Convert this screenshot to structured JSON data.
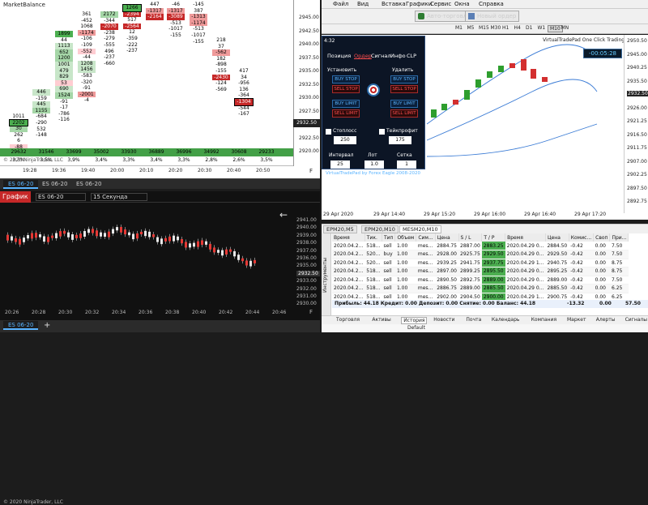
{
  "mb": {
    "title": "MarketBalance",
    "axis": [
      "2945.00",
      "2942.50",
      "2940.00",
      "2937.50",
      "2935.00",
      "2932.50",
      "2930.00",
      "2927.50",
      "2925.00",
      "2922.50",
      "2920.00"
    ],
    "price": "2932.50",
    "totals": [
      "29632",
      "31546",
      "33699",
      "35002",
      "33930",
      "36889",
      "36996",
      "34992",
      "30608",
      "29233"
    ],
    "percents": [
      "3,3%",
      "3,5%",
      "3,9%",
      "3,4%",
      "3,3%",
      "3,4%",
      "3,3%",
      "2,8%",
      "2,6%",
      "3,5%"
    ],
    "times": [
      "19:28",
      "19:36",
      "19:40",
      "20:00",
      "20:10",
      "20:20",
      "20:30",
      "20:40",
      "20:50"
    ],
    "copyright": "© 2020 NinjaTrader, LLC",
    "axis_toggle": "F"
  },
  "tabs1": [
    "ES 06-20",
    "ES 06-20",
    "ES 06-20"
  ],
  "chart2": {
    "label": "График",
    "instrument": "ES 06-20",
    "period": "15 Секунда",
    "axis": [
      "2941.00",
      "2940.00",
      "2939.00",
      "2938.00",
      "2937.00",
      "2936.00",
      "2935.00",
      "2934.00",
      "2933.00",
      "2932.00",
      "2931.00",
      "2930.00"
    ],
    "price": "2932.50",
    "times": [
      "20:26",
      "20:28",
      "20:30",
      "20:32",
      "20:34",
      "20:36",
      "20:38",
      "20:40",
      "20:42",
      "20:44",
      "20:46"
    ],
    "copyright": "© 2020 NinjaTrader, LLC",
    "axis_toggle": "F",
    "back_arrow": "←"
  },
  "tabs2": [
    "ES 06-20"
  ],
  "mt": {
    "menu": [
      "Файл",
      "Вид",
      "Вставка",
      "Графики",
      "Сервис",
      "Окна",
      "Справка"
    ],
    "toolbar": {
      "auto": "Авто-торговля",
      "new_order": "Новый ордер"
    },
    "timeframes": [
      "M1",
      "M5",
      "M15",
      "M30",
      "H1",
      "H4",
      "D1",
      "W1",
      "MN"
    ],
    "tf_active": "M10",
    "chart_title": "VirtualTradePad One Click Trading Panel",
    "timer": "-00:05:28",
    "axis": [
      "2950.50",
      "2945.00",
      "2940.25",
      "2935.50",
      "2930.75",
      "2926.00",
      "2921.25",
      "2916.50",
      "2911.75",
      "2907.00",
      "2902.25",
      "2897.50",
      "2892.75"
    ],
    "bid_price": "2932.50",
    "times": [
      "29 Apr 2020",
      "29 Apr 14:40",
      "29 Apr 15:20",
      "29 Apr 16:00",
      "29 Apr 16:40",
      "29 Apr 17:20"
    ],
    "chart_tabs": [
      "EPM20,M5",
      "EPM20,M10",
      "MESM20,M10"
    ]
  },
  "vp": {
    "title": "4:32",
    "tabs": [
      "Позиция",
      "Ордер",
      "Сигнал",
      "Инфо",
      "CLP"
    ],
    "set": "Установить",
    "del": "Удалить",
    "buy_stop": "BUY STOP",
    "sell_stop": "SELL STOP",
    "buy_limit": "BUY LIMIT",
    "sell_limit": "SELL LIMIT",
    "sl_label": "Стоплосс",
    "sl_value": "250",
    "tp_label": "Тейкпрофит",
    "tp_value": "175",
    "interval_label": "Интервал",
    "interval_value": "25",
    "lot_label": "Лот",
    "lot_value": "1.0",
    "grid_label": "Сетка",
    "grid_value": "1",
    "footer": "VirtualTradePad by Forex Eagle 2008-2020"
  },
  "terminal": {
    "side_label": "Инструменты",
    "headers": [
      "Время",
      "Тик.",
      "Тип",
      "Объем",
      "Сим...",
      "Цена",
      "S / L",
      "T / P",
      "Время",
      "Цена",
      "Комис...",
      "Своп",
      "При..."
    ],
    "rows": [
      [
        "2020.04.2...",
        "518...",
        "sell",
        "1.00",
        "mes...",
        "2884.75",
        "2887.00",
        "2883.25",
        "2020.04.29 0...",
        "2884.50",
        "-0.42",
        "0.00",
        "7.50"
      ],
      [
        "2020.04.2...",
        "520...",
        "buy",
        "1.00",
        "mes...",
        "2928.00",
        "2925.75",
        "2929.50",
        "2020.04.29 0...",
        "2929.50",
        "-0.42",
        "0.00",
        "7.50"
      ],
      [
        "2020.04.2...",
        "520...",
        "sell",
        "1.00",
        "mes...",
        "2939.25",
        "2941.75",
        "2937.75",
        "2020.04.29 1...",
        "2940.75",
        "-0.42",
        "0.00",
        "8.75"
      ],
      [
        "2020.04.2...",
        "518...",
        "sell",
        "1.00",
        "mes...",
        "2897.00",
        "2899.25",
        "2895.50",
        "2020.04.29 0...",
        "2895.25",
        "-0.42",
        "0.00",
        "8.75"
      ],
      [
        "2020.04.2...",
        "518...",
        "sell",
        "1.00",
        "mes...",
        "2890.50",
        "2892.75",
        "2889.00",
        "2020.04.29 0...",
        "2889.00",
        "-0.42",
        "0.00",
        "7.50"
      ],
      [
        "2020.04.2...",
        "518...",
        "sell",
        "1.00",
        "mes...",
        "2886.75",
        "2889.00",
        "2885.50",
        "2020.04.29 0...",
        "2885.50",
        "-0.42",
        "0.00",
        "6.25"
      ],
      [
        "2020.04.2...",
        "518...",
        "sell",
        "1.00",
        "mes...",
        "2902.00",
        "2904.50",
        "2900.00",
        "2020.04.29 1...",
        "2900.75",
        "-0.42",
        "0.00",
        "6.25"
      ]
    ],
    "summary": "Прибыль: 44.18  Кредит: 0.00  Депозит: 0.00  Снятие: 0.00  Баланс: 44.18",
    "summary_comm": "-13.32",
    "summary_swap": "0.00",
    "summary_profit": "57.50",
    "tabs": [
      "Торговля",
      "Активы",
      "История",
      "Новости",
      "Почта",
      "Календарь",
      "Компания",
      "Маркет",
      "Алерты",
      "Сигналы",
      "Статьи"
    ],
    "tab_active": "История",
    "last": "Default"
  },
  "colors": {
    "buy": "#2e7d32",
    "sell": "#c62828",
    "accent": "#5ab4ff"
  }
}
